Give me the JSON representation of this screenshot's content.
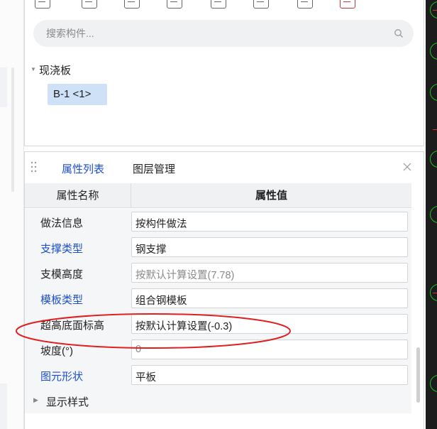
{
  "search": {
    "placeholder": "搜索构件..."
  },
  "tree": {
    "group_label": "现浇板",
    "items": [
      {
        "label": "B-1 <1>"
      }
    ]
  },
  "tabs": [
    {
      "label": "属性列表",
      "active": true
    },
    {
      "label": "图层管理",
      "active": false
    }
  ],
  "table": {
    "header_name": "属性名称",
    "header_value": "属性值",
    "rows": [
      {
        "name": "做法信息",
        "value": "按构件做法",
        "name_link": false,
        "value_grey": false
      },
      {
        "name": "支撑类型",
        "value": "钢支撑",
        "name_link": true,
        "value_grey": false
      },
      {
        "name": "支模高度",
        "value": "按默认计算设置(7.78)",
        "name_link": false,
        "value_grey": true
      },
      {
        "name": "模板类型",
        "value": "组合钢模板",
        "name_link": true,
        "value_grey": false
      },
      {
        "name": "超高底面标高",
        "value": "按默认计算设置(-0.3)",
        "name_link": false,
        "value_grey": false
      },
      {
        "name": "坡度(°)",
        "value": "0",
        "name_link": false,
        "value_grey": true
      },
      {
        "name": "图元形状",
        "value": "平板",
        "name_link": true,
        "value_grey": false
      }
    ],
    "collapsed_group": "显示样式"
  },
  "colors": {
    "accent_blue": "#1d4fcc",
    "chip_bg": "#cfe1f7",
    "annotation_red": "#e02020",
    "canvas_bg": "#1c1c1c",
    "canvas_line": "#1fc21f"
  },
  "icons": {
    "toolbar": [
      "new-icon",
      "copy-icon",
      "delete-icon",
      "layer-copy-icon",
      "pick-icon",
      "edit-icon",
      "list-icon",
      "filter-icon"
    ],
    "search": "search-icon",
    "close": "close-icon",
    "drag": "drag-handle-icon"
  }
}
